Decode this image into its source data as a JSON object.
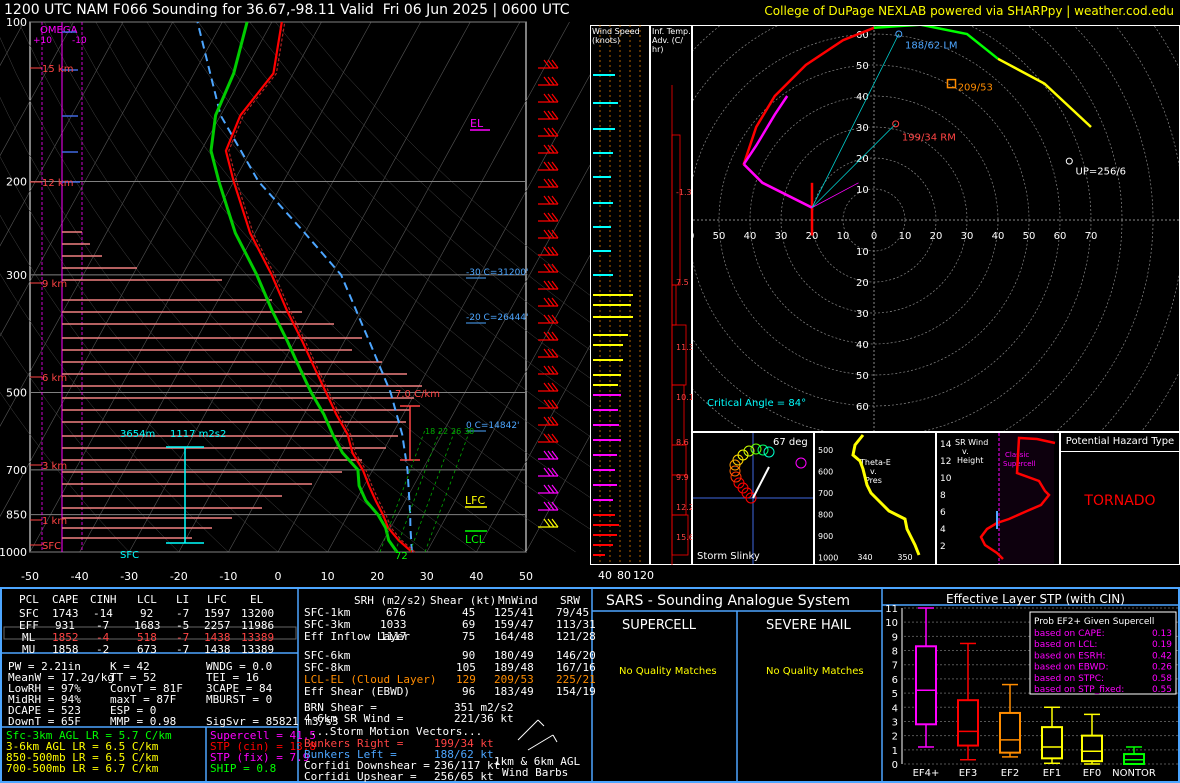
{
  "header": {
    "title": "1200 UTC NAM F066 Sounding for 36.67,-98.11 Valid  Fri 06 Jun 2025 | 0600 UTC",
    "credit": "College of DuPage NEXLAB powered via SHARPpy | weather.cod.edu"
  },
  "colors": {
    "temp": "#ff0000",
    "dewpoint": "#00cc00",
    "virtual_temp": "#b22222",
    "parcel": "#4da6ff",
    "isobar": "#808080",
    "hodo_0_3": "#ff0000",
    "hodo_3_6": "#ff00ff",
    "hodo_6_9": "#00ff00",
    "hodo_9_12": "#ffff00",
    "cyan": "#00ffff",
    "magenta": "#ff00ff"
  },
  "chart_data": [
    {
      "type": "line",
      "name": "skew-t",
      "y_ticks": [
        "100",
        "200",
        "300",
        "500",
        "700",
        "850",
        "1000"
      ],
      "pressure_levels": [
        100,
        200,
        300,
        500,
        700,
        850,
        1000
      ],
      "x_ticks": [
        "-50",
        "-40",
        "-30",
        "-20",
        "-10",
        "0",
        "10",
        "20",
        "30",
        "40",
        "50"
      ],
      "xlim": [
        -50,
        50
      ],
      "ylim": [
        1000,
        100
      ],
      "height_labels": [
        "15 km",
        "12 km",
        "9 km",
        "6 km",
        "3 km",
        "1 km",
        "SFC"
      ],
      "omega_label": "OMEGA",
      "omega_ticks": [
        "+10",
        "-10"
      ],
      "temperature": [
        [
          1000,
          27
        ],
        [
          950,
          23
        ],
        [
          900,
          19.5
        ],
        [
          850,
          17
        ],
        [
          800,
          14
        ],
        [
          750,
          11
        ],
        [
          700,
          8
        ],
        [
          650,
          4
        ],
        [
          600,
          1
        ],
        [
          550,
          -3.5
        ],
        [
          500,
          -8
        ],
        [
          450,
          -13
        ],
        [
          400,
          -18.5
        ],
        [
          350,
          -25
        ],
        [
          300,
          -32
        ],
        [
          250,
          -41
        ],
        [
          200,
          -50
        ],
        [
          175,
          -55
        ],
        [
          150,
          -56
        ],
        [
          125,
          -54
        ],
        [
          100,
          -58
        ]
      ],
      "dewpoint": [
        [
          1000,
          24
        ],
        [
          950,
          21
        ],
        [
          900,
          19
        ],
        [
          850,
          16
        ],
        [
          800,
          12
        ],
        [
          750,
          9
        ],
        [
          700,
          7
        ],
        [
          650,
          2
        ],
        [
          600,
          -2
        ],
        [
          550,
          -6
        ],
        [
          500,
          -11
        ],
        [
          450,
          -16
        ],
        [
          400,
          -21.5
        ],
        [
          350,
          -28
        ],
        [
          300,
          -35
        ],
        [
          250,
          -44
        ],
        [
          200,
          -53
        ],
        [
          175,
          -58
        ],
        [
          150,
          -61
        ],
        [
          125,
          -62
        ],
        [
          100,
          -65
        ]
      ],
      "parcel": [
        [
          1000,
          27
        ],
        [
          900,
          24
        ],
        [
          850,
          22.5
        ],
        [
          700,
          17
        ],
        [
          600,
          12
        ],
        [
          500,
          5
        ],
        [
          400,
          -5
        ],
        [
          300,
          -18
        ],
        [
          250,
          -30
        ],
        [
          200,
          -45
        ],
        [
          150,
          -60
        ],
        [
          100,
          -75
        ]
      ],
      "annotations": {
        "el": "EL",
        "lfc": "LFC",
        "lcl": "LCL",
        "minus30": "-30 C=31200'",
        "minus20": "-20 C=26444'",
        "zero": "0 C=14842'",
        "lapse": "7.0 C/km",
        "esrh_height": "3654m",
        "esrh": "1117 m2s2",
        "sfc_temp": "72",
        "sfc": "SFC",
        "dgz1": "18",
        "dgz2": "22",
        "dgz3": "26",
        "dgz4": "30"
      }
    },
    {
      "type": "bar",
      "name": "wind-speed-profile",
      "title_line1": "Wind Speed",
      "title_line2": "(knots)",
      "x_ticks": [
        "40",
        "80",
        "120"
      ]
    },
    {
      "type": "bar",
      "name": "inferred-temp-advection",
      "title_line1": "Inf. Temp.",
      "title_line2": "Adv. (C/",
      "title_line3": "hr)",
      "value_labels": [
        "-1.3",
        "7.5",
        "11.3",
        "10.1",
        "8.6",
        "9.9",
        "12.2",
        "15.6"
      ]
    },
    {
      "type": "line",
      "name": "hodograph",
      "ring_labels_y": [
        "60",
        "50",
        "40",
        "30",
        "20",
        "10"
      ],
      "ring_labels_y_neg": [
        "10",
        "20",
        "30",
        "40",
        "50",
        "60"
      ],
      "ring_labels_x": [
        "0",
        "70",
        "60",
        "50",
        "40",
        "30",
        "20",
        "10",
        "0",
        "10",
        "20",
        "30",
        "40",
        "50",
        "60",
        "70"
      ],
      "lm_label": "188/62 LM",
      "rm_label": "199/34 RM",
      "mean_label": "209/53",
      "up_label": "UP=256/6",
      "critical_angle": "Critical Angle = 84°"
    },
    {
      "type": "scatter",
      "name": "storm-slinky",
      "title": "Storm Slinky",
      "deg_label": "67 deg"
    },
    {
      "type": "line",
      "name": "theta-e",
      "title_line1": "Theta-E",
      "title_line2": "v.",
      "title_line3": "Pres",
      "y_ticks": [
        "500",
        "600",
        "700",
        "800",
        "900",
        "1000"
      ],
      "x_ticks": [
        "340",
        "350",
        "360"
      ]
    },
    {
      "type": "line",
      "name": "sr-wind-height",
      "title_line1": "SR Wind",
      "title_line2": "v.",
      "title_line3": "Height",
      "y_ticks": [
        "14",
        "12",
        "10",
        "8",
        "6",
        "4",
        "2"
      ],
      "supercell_label1": "Classic",
      "supercell_label2": "Supercell"
    },
    {
      "type": "bar",
      "name": "effective-layer-stp",
      "title": "Effective Layer STP (with CIN)",
      "categories": [
        "EF4+",
        "EF3",
        "EF2",
        "EF1",
        "EF0",
        "NONTOR"
      ],
      "y_ticks": [
        "0",
        "1",
        "2",
        "3",
        "4",
        "5",
        "6",
        "7",
        "8",
        "9",
        "10",
        "11"
      ],
      "ylim": [
        0,
        11
      ],
      "boxes": [
        {
          "whisker_low": 1.2,
          "q1": 2.8,
          "median": 5.2,
          "q3": 8.3,
          "whisker_high": 11,
          "color": "#ff00ff"
        },
        {
          "whisker_low": 0.3,
          "q1": 1.3,
          "median": 2.3,
          "q3": 4.5,
          "whisker_high": 8.5,
          "color": "#ff0000"
        },
        {
          "whisker_low": 0.5,
          "q1": 0.8,
          "median": 1.7,
          "q3": 3.6,
          "whisker_high": 5.6,
          "color": "#ff8c00"
        },
        {
          "whisker_low": 0.05,
          "q1": 0.4,
          "median": 1.2,
          "q3": 2.6,
          "whisker_high": 4,
          "color": "#ffff00"
        },
        {
          "whisker_low": 0.0,
          "q1": 0.2,
          "median": 0.9,
          "q3": 2.0,
          "whisker_high": 3.5,
          "color": "#ffff00"
        },
        {
          "whisker_low": 0.0,
          "q1": 0.0,
          "median": 0.3,
          "q3": 0.7,
          "whisker_high": 1.2,
          "color": "#00ff00"
        }
      ],
      "prob_title": "Prob EF2+ Given Supercell",
      "prob_rows": [
        {
          "label": "based on CAPE:",
          "value": "0.13"
        },
        {
          "label": "based on LCL:",
          "value": "0.19"
        },
        {
          "label": "based on ESRH:",
          "value": "0.42"
        },
        {
          "label": "based on EBWD:",
          "value": "0.26"
        },
        {
          "label": "based on STPC:",
          "value": "0.58"
        },
        {
          "label": "based on STP_fixed:",
          "value": "0.55"
        }
      ]
    }
  ],
  "hazard": {
    "title": "Potential Hazard Type",
    "value": "TORNADO"
  },
  "parcels": {
    "headers": [
      "PCL",
      "CAPE",
      "CINH",
      "LCL",
      "LI",
      "LFC",
      "EL"
    ],
    "rows": [
      [
        "SFC",
        "1743",
        "-14",
        "92",
        "-7",
        "1597",
        "13200"
      ],
      [
        "EFF",
        "931",
        "-7",
        "1683",
        "-5",
        "2257",
        "11986"
      ],
      [
        "ML",
        "1852",
        "-4",
        "518",
        "-7",
        "1438",
        "13389"
      ],
      [
        "MU",
        "1858",
        "-2",
        "673",
        "-7",
        "1438",
        "13389"
      ]
    ]
  },
  "indices": {
    "col1": [
      "PW = 2.21in",
      "MeanW = 17.2g/kg",
      "LowRH = 97%",
      "MidRH = 94%",
      "DCAPE = 523",
      "DownT = 65F"
    ],
    "col2": [
      "K = 42",
      "TT = 52",
      "ConvT = 81F",
      "maxT = 87F",
      "ESP = 0",
      "MMP = 0.98"
    ],
    "col3": [
      "WNDG = 0.0",
      "TEI = 16",
      "3CAPE = 84",
      "MBURST = 0",
      "",
      "SigSvr = 85821 m3/s3"
    ]
  },
  "lapse_rates": [
    "Sfc-3km AGL LR = 5.7 C/km",
    "3-6km AGL LR = 6.5 C/km",
    "850-500mb LR = 6.5 C/km",
    "700-500mb LR = 6.7 C/km"
  ],
  "composites": [
    {
      "text": "Supercell = 41.5",
      "color": "#ff00ff"
    },
    {
      "text": "STP (cin) = 13.8",
      "color": "#ff0000"
    },
    {
      "text": "STP (fix) = 7.9",
      "color": "#ff00ff"
    },
    {
      "text": "SHIP = 0.8",
      "color": "#00ff00"
    }
  ],
  "kinematics": {
    "headers": [
      "SRH (m2/s2)",
      "Shear (kt)",
      "MnWind",
      "SRW"
    ],
    "rows": [
      [
        "SFC-1km",
        "676",
        "45",
        "125/41",
        "79/45"
      ],
      [
        "SFC-3km",
        "1033",
        "69",
        "159/47",
        "113/31"
      ],
      [
        "Eff Inflow Layer",
        "1117",
        "75",
        "164/48",
        "121/28"
      ],
      [
        "SFC-6km",
        "90",
        "180/49",
        "146/20",
        ""
      ],
      [
        "SFC-8km",
        "105",
        "189/48",
        "167/16",
        ""
      ],
      [
        "LCL-EL (Cloud Layer)",
        "129",
        "209/53",
        "225/21",
        ""
      ],
      [
        "Eff Shear (EBWD)",
        "96",
        "183/49",
        "154/19",
        ""
      ]
    ],
    "brn_shear_label": "BRN Shear =",
    "brn_shear": "351 m2/s2",
    "sr_wind_label": "4-6km SR Wind =",
    "sr_wind": "221/36 kt",
    "storm_motion": "...Storm Motion Vectors...",
    "vectors": [
      {
        "label": "Bunkers Right =",
        "value": "199/34 kt",
        "color": "#ff4444"
      },
      {
        "label": "Bunkers Left =",
        "value": "188/62 kt",
        "color": "#4da6ff"
      },
      {
        "label": "Corfidi Downshear =",
        "value": "236/117 kt",
        "color": "#ffffff"
      },
      {
        "label": "Corfidi Upshear =",
        "value": "256/65 kt",
        "color": "#ffffff"
      }
    ],
    "barb_label1": "1km & 6km AGL",
    "barb_label2": "Wind Barbs"
  },
  "sars": {
    "title": "SARS - Sounding Analogue System",
    "supercell": "SUPERCELL",
    "hail": "SEVERE HAIL",
    "supercell_result": "No Quality Matches",
    "hail_result": "No Quality Matches"
  }
}
